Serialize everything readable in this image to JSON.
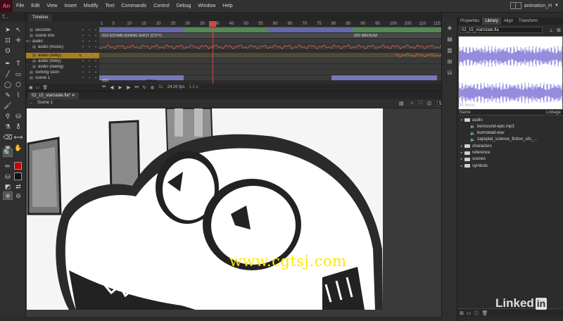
{
  "app": {
    "logo": "An",
    "menu": [
      "File",
      "Edit",
      "View",
      "Insert",
      "Modify",
      "Text",
      "Commands",
      "Control",
      "Debug",
      "Window",
      "Help"
    ],
    "workspace": "animation_H"
  },
  "tools_panel": {
    "title": "T..."
  },
  "timeline": {
    "tab_label": "Timeline",
    "layers": [
      {
        "name": "seconds",
        "icon": "layer-icon"
      },
      {
        "name": "scene info",
        "icon": "layer-icon"
      },
      {
        "name": "audio",
        "icon": "folder-icon"
      },
      {
        "name": "audio (music)",
        "icon": "layer-icon"
      },
      {
        "name": "audio (foley)",
        "icon": "layer-icon",
        "selected": true
      },
      {
        "name": "audio (foley)",
        "icon": "layer-icon"
      },
      {
        "name": "audio (dialog)",
        "icon": "layer-icon"
      },
      {
        "name": "coming soon",
        "icon": "layer-icon"
      },
      {
        "name": "scene 1",
        "icon": "layer-icon"
      }
    ],
    "frame_numbers": [
      "1",
      "5",
      "10",
      "15",
      "20",
      "25",
      "30",
      "35",
      "40",
      "45",
      "50",
      "55",
      "60",
      "65",
      "70",
      "75",
      "80",
      "85",
      "90",
      "95",
      "100",
      "105",
      "110",
      "115"
    ],
    "frame_labels": {
      "establishing": "010 ESTABLISHING SHOT (CITY)",
      "medium": "020 MEDIUM",
      "scene_a": "010",
      "scene_b": "robo n"
    },
    "status": {
      "frame": "31",
      "fps": "24.00 fps",
      "time": "1.3 s"
    }
  },
  "document": {
    "tab": "02_15_startstate.fla*",
    "scene": "Scene 1",
    "zoom": "53%"
  },
  "watermark": "www.cgtsj.com",
  "library": {
    "tabs": [
      "Properties",
      "Library",
      "Align",
      "Transform"
    ],
    "active_tab": "Library",
    "file": "02_15_startstate.fla",
    "item_count": "48 Items",
    "col_name": "Name",
    "col_linkage": "Linkage",
    "items": [
      {
        "name": "audio",
        "kind": "folder",
        "expanded": true,
        "depth": 0
      },
      {
        "name": "bensound-epic.mp3",
        "kind": "sound",
        "depth": 1
      },
      {
        "name": "bumstead.wav",
        "kind": "sound",
        "depth": 1
      },
      {
        "name": "zapsplat_science_fiction_ufo_...",
        "kind": "sound",
        "depth": 1
      },
      {
        "name": "characters",
        "kind": "folder",
        "expanded": false,
        "depth": 0
      },
      {
        "name": "reference",
        "kind": "folder",
        "expanded": false,
        "depth": 0
      },
      {
        "name": "scenes",
        "kind": "folder",
        "expanded": false,
        "depth": 0
      },
      {
        "name": "symbols",
        "kind": "folder",
        "expanded": false,
        "depth": 0
      }
    ]
  },
  "brand": {
    "name": "Linked",
    "in": "in"
  },
  "colors": {
    "stroke": "#cc0000",
    "fill": "#111111",
    "selected_layer": "#a88020",
    "watermark": "#ffe600",
    "waveform": "#7b6fd6"
  }
}
